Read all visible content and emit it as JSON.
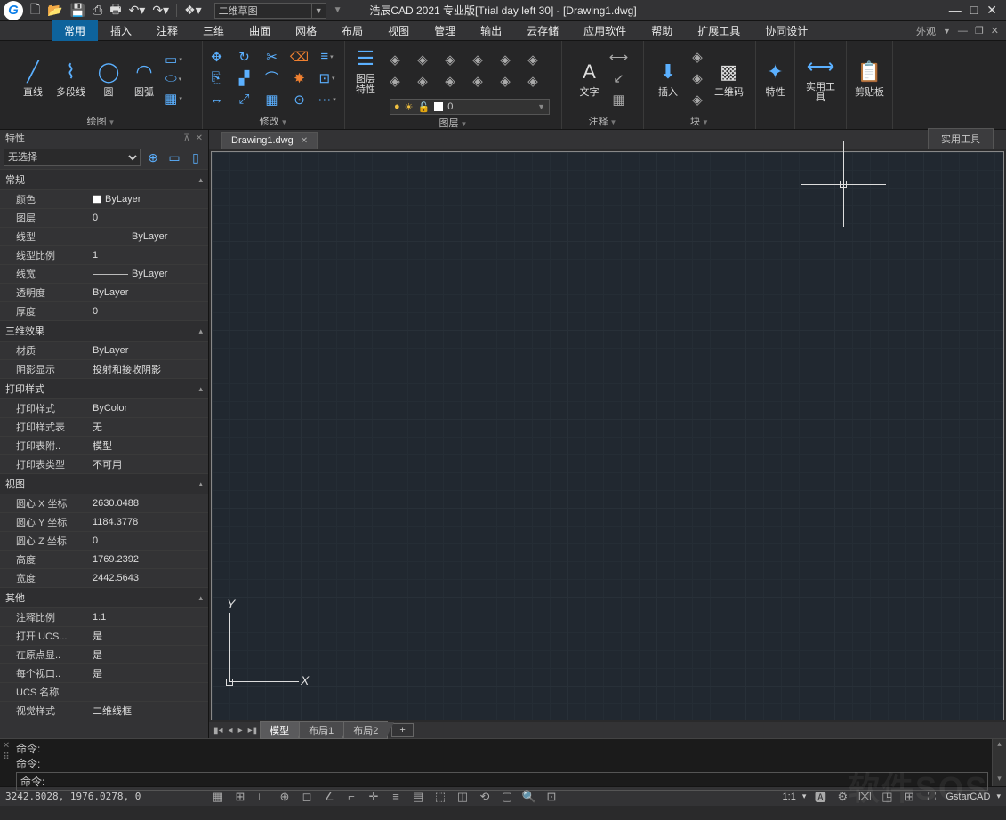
{
  "titlebar": {
    "title": "浩辰CAD 2021 专业版[Trial day left 30] - [Drawing1.dwg]",
    "workspace": "二维草图"
  },
  "menu": {
    "tabs": [
      "常用",
      "插入",
      "注释",
      "三维",
      "曲面",
      "网格",
      "布局",
      "视图",
      "管理",
      "输出",
      "云存储",
      "应用软件",
      "帮助",
      "扩展工具",
      "协同设计"
    ],
    "active": 0,
    "appearance": "外观"
  },
  "ribbon": {
    "draw": {
      "label": "绘图",
      "line": "直线",
      "polyline": "多段线",
      "circle": "圆",
      "arc": "圆弧"
    },
    "modify": {
      "label": "修改"
    },
    "layer": {
      "label": "图层",
      "btn": "图层\n特性",
      "current": "0"
    },
    "text": {
      "label": "注释",
      "btn": "文字"
    },
    "block": {
      "label": "块",
      "insert": "插入",
      "qr": "二维码"
    },
    "prop": {
      "label": "特性"
    },
    "util": {
      "label": "实用工具"
    },
    "clip": {
      "label": "剪贴板"
    }
  },
  "doc": {
    "tab": "Drawing1.dwg",
    "sidetab": "实用工具"
  },
  "properties": {
    "title": "特性",
    "selector": "无选择",
    "groups": [
      {
        "name": "常规",
        "rows": [
          {
            "k": "颜色",
            "v": "ByLayer",
            "swatch": true
          },
          {
            "k": "图层",
            "v": "0"
          },
          {
            "k": "线型",
            "v": "ByLayer",
            "line": true
          },
          {
            "k": "线型比例",
            "v": "1"
          },
          {
            "k": "线宽",
            "v": "ByLayer",
            "line": true
          },
          {
            "k": "透明度",
            "v": "ByLayer"
          },
          {
            "k": "厚度",
            "v": "0"
          }
        ]
      },
      {
        "name": "三维效果",
        "rows": [
          {
            "k": "材质",
            "v": "ByLayer"
          },
          {
            "k": "阴影显示",
            "v": "投射和接收阴影"
          }
        ]
      },
      {
        "name": "打印样式",
        "rows": [
          {
            "k": "打印样式",
            "v": "ByColor"
          },
          {
            "k": "打印样式表",
            "v": "无"
          },
          {
            "k": "打印表附..",
            "v": "模型"
          },
          {
            "k": "打印表类型",
            "v": "不可用"
          }
        ]
      },
      {
        "name": "视图",
        "rows": [
          {
            "k": "圆心 X 坐标",
            "v": "2630.0488"
          },
          {
            "k": "圆心 Y 坐标",
            "v": "1184.3778"
          },
          {
            "k": "圆心 Z 坐标",
            "v": "0"
          },
          {
            "k": "高度",
            "v": "1769.2392"
          },
          {
            "k": "宽度",
            "v": "2442.5643"
          }
        ]
      },
      {
        "name": "其他",
        "rows": [
          {
            "k": "注释比例",
            "v": "1:1"
          },
          {
            "k": "打开 UCS...",
            "v": "是"
          },
          {
            "k": "在原点显..",
            "v": "是"
          },
          {
            "k": "每个视口..",
            "v": "是"
          },
          {
            "k": "UCS 名称",
            "v": ""
          },
          {
            "k": "视觉样式",
            "v": "二维线框"
          }
        ]
      }
    ]
  },
  "model_tabs": {
    "model": "模型",
    "layout1": "布局1",
    "layout2": "布局2"
  },
  "command": {
    "hist1": "命令:",
    "hist2": "命令:",
    "prompt": "命令:"
  },
  "status": {
    "coords": "3242.8028, 1976.0278, 0",
    "scale": "1:1",
    "brand": "GstarCAD"
  },
  "watermark": "软件SOS"
}
